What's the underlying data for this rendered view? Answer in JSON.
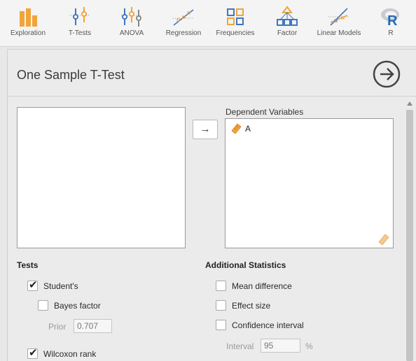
{
  "toolbar": {
    "items": [
      {
        "label": "Exploration",
        "icon": "exploration-icon"
      },
      {
        "label": "T-Tests",
        "icon": "t-tests-icon"
      },
      {
        "label": "ANOVA",
        "icon": "anova-icon"
      },
      {
        "label": "Regression",
        "icon": "regression-icon"
      },
      {
        "label": "Frequencies",
        "icon": "frequencies-icon"
      },
      {
        "label": "Factor",
        "icon": "factor-icon"
      },
      {
        "label": "Linear Models",
        "icon": "linear-models-icon"
      },
      {
        "label": "R",
        "icon": "r-icon"
      }
    ]
  },
  "analysis": {
    "title": "One Sample T-Test",
    "dependent_variables_label": "Dependent Variables",
    "dependent_variables": [
      {
        "name": "A",
        "icon": "continuous-variable-icon"
      }
    ],
    "move_button": "→"
  },
  "tests": {
    "heading": "Tests",
    "students": {
      "label": "Student's",
      "checked": true
    },
    "bayes_factor": {
      "label": "Bayes factor",
      "checked": false
    },
    "prior_label": "Prior",
    "prior_value": "0.707",
    "wilcoxon": {
      "label": "Wilcoxon rank",
      "checked": true
    }
  },
  "additional_statistics": {
    "heading": "Additional Statistics",
    "mean_difference": {
      "label": "Mean difference",
      "checked": false
    },
    "effect_size": {
      "label": "Effect size",
      "checked": false
    },
    "confidence_interval": {
      "label": "Confidence interval",
      "checked": false
    },
    "interval_label": "Interval",
    "interval_value": "95",
    "interval_unit": "%"
  },
  "colors": {
    "accent": "#f0a43a",
    "icon_blue": "#3f77c0",
    "gray": "#999999"
  }
}
